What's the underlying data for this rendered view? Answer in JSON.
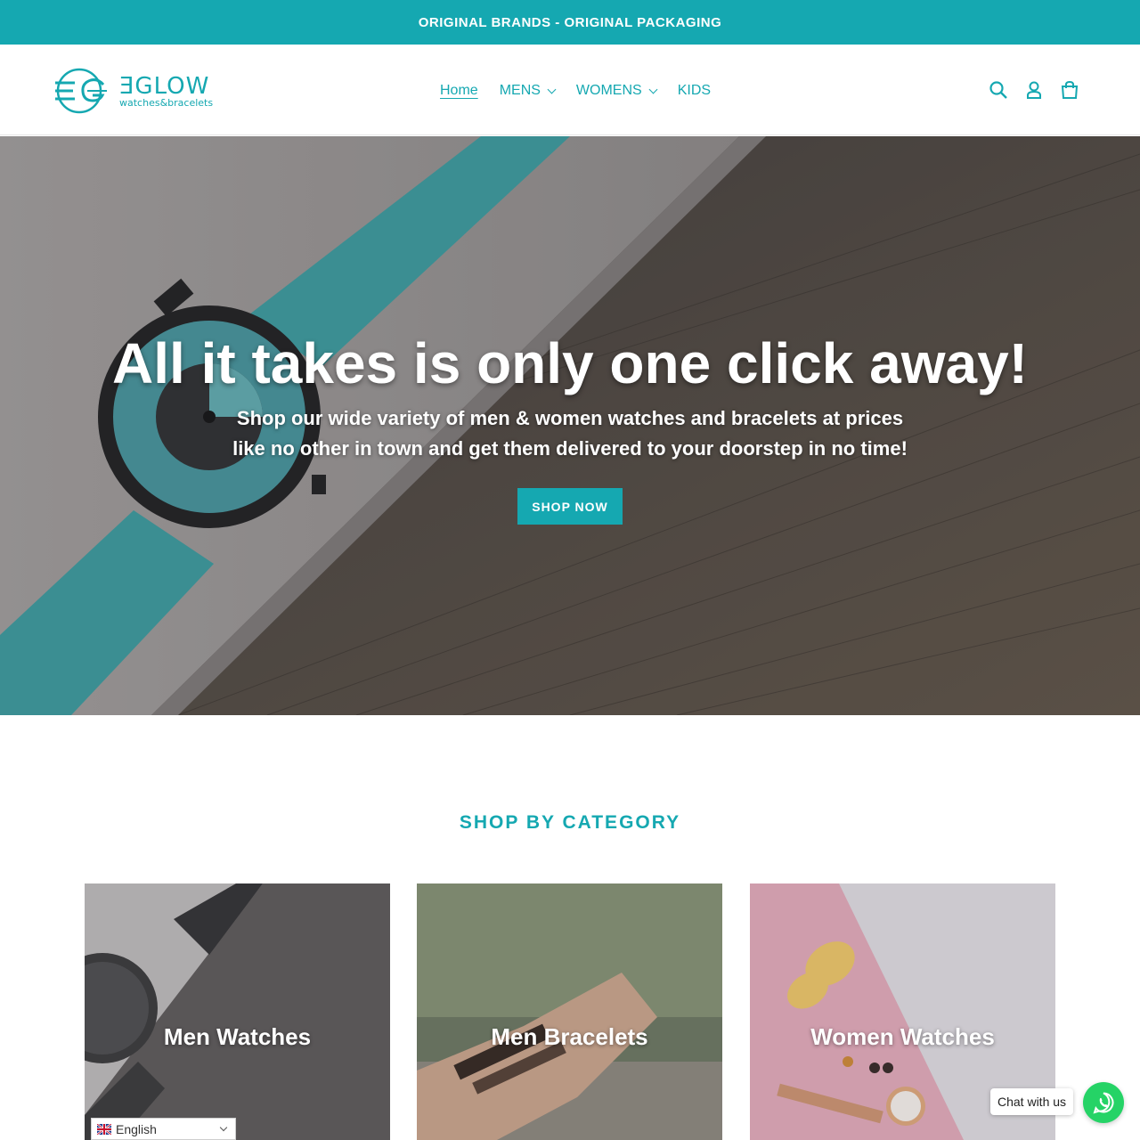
{
  "announcement": {
    "text": "ORIGINAL BRANDS - ORIGINAL PACKAGING"
  },
  "header": {
    "logo": {
      "mark": "ƎG",
      "name": "ƎGLOW",
      "tagline": "watches&bracelets"
    },
    "nav": [
      {
        "label": "Home",
        "active": true,
        "dropdown": false
      },
      {
        "label": "MENS",
        "active": false,
        "dropdown": true
      },
      {
        "label": "WOMENS",
        "active": false,
        "dropdown": true
      },
      {
        "label": "KIDS",
        "active": false,
        "dropdown": false
      }
    ],
    "icons": [
      "search-icon",
      "account-icon",
      "cart-icon"
    ]
  },
  "hero": {
    "title": "All it takes is only one click away!",
    "subtitle_line1": "Shop our wide variety of men & women watches and bracelets at prices",
    "subtitle_line2": "like no other in town and get them delivered to your doorstep in no time!",
    "button": "SHOP NOW"
  },
  "categories": {
    "title": "SHOP BY CATEGORY",
    "items": [
      {
        "label": "Men Watches"
      },
      {
        "label": "Men Bracelets"
      },
      {
        "label": "Women Watches"
      }
    ]
  },
  "language": {
    "selected": "English"
  },
  "chat": {
    "label": "Chat with us"
  },
  "colors": {
    "accent": "#15a8b1",
    "whatsapp": "#25d366",
    "white": "#ffffff"
  }
}
